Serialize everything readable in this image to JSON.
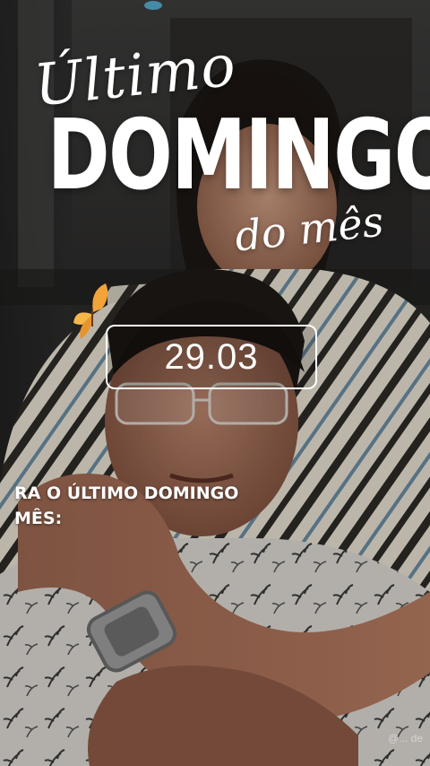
{
  "story": {
    "title_script": "Último",
    "title_main": "DOMINGO",
    "title_sub": "do mês",
    "date": "29.03",
    "caption_line1": "RA O ÚLTIMO DOMINGO",
    "caption_line2": "MÊS:",
    "watermark": "@... de"
  },
  "icons": {
    "butterfly": "butterfly-icon",
    "top_light": "light-icon"
  },
  "colors": {
    "text": "#ffffff",
    "butterfly": "#f2a33a"
  }
}
